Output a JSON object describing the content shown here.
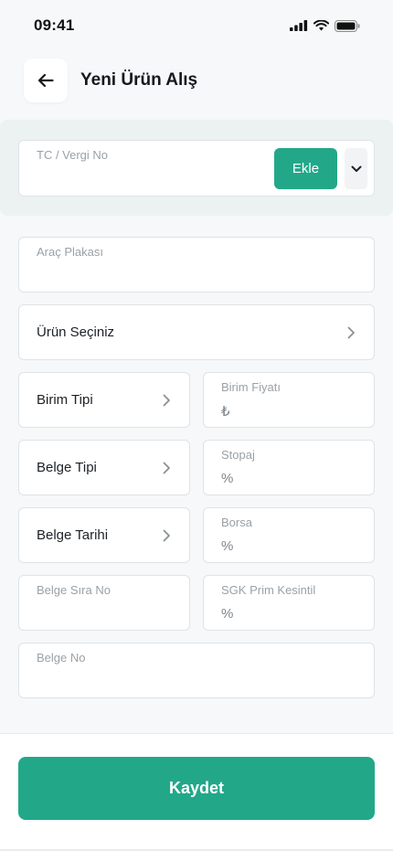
{
  "status_bar": {
    "time": "09:41"
  },
  "header": {
    "title": "Yeni Ürün Alış"
  },
  "tc_field": {
    "label": "TC / Vergi No",
    "add_label": "Ekle"
  },
  "plate_field": {
    "label": "Araç Plakası"
  },
  "product_select": {
    "label": "Ürün Seçiniz"
  },
  "unit_type_select": {
    "label": "Birim Tipi"
  },
  "unit_price_field": {
    "label": "Birim Fiyatı",
    "unit": "₺"
  },
  "document_type_select": {
    "label": "Belge Tipi"
  },
  "stopaj_field": {
    "label": "Stopaj",
    "unit": "%"
  },
  "document_date_select": {
    "label": "Belge Tarihi"
  },
  "borsa_field": {
    "label": "Borsa",
    "unit": "%"
  },
  "document_seq_field": {
    "label": "Belge Sıra No"
  },
  "sgk_field": {
    "label": "SGK Prim Kesintil",
    "unit": "%"
  },
  "document_no_field": {
    "label": "Belge No"
  },
  "footer": {
    "save_label": "Kaydet"
  },
  "colors": {
    "accent": "#22a889",
    "border": "#dfe3e6",
    "background": "#f6f8f9"
  },
  "icons": [
    "signal-icon",
    "wifi-icon",
    "battery-icon",
    "arrow-left-icon",
    "chevron-down-icon",
    "chevron-right-icon"
  ]
}
